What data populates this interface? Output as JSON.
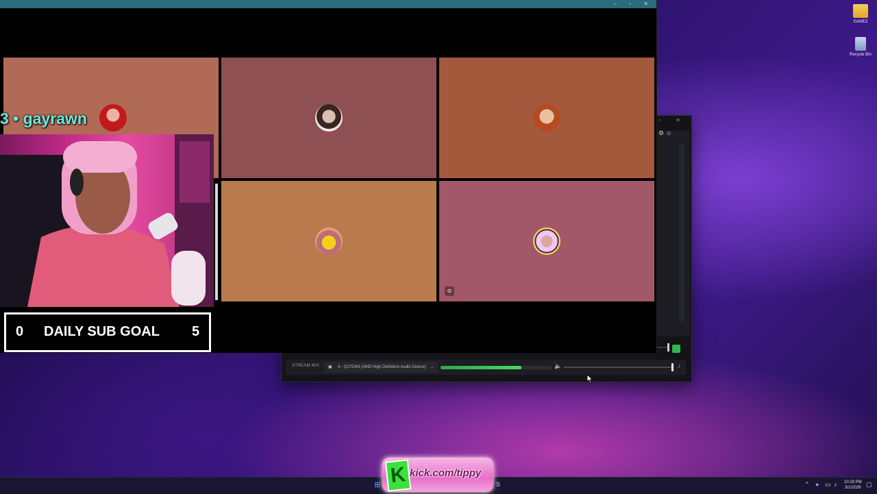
{
  "desktop": {
    "icons": [
      {
        "label": "GAMEZ",
        "icon": "folder-icon"
      },
      {
        "label": "Recycle Bin",
        "icon": "recycle-bin-icon"
      }
    ]
  },
  "call": {
    "participants": [
      {
        "name": "gayrawn",
        "tile_color": "#b06a56"
      },
      {
        "tile_color": "#8e5052"
      },
      {
        "tile_color": "#a5593c"
      },
      {
        "tile_color": "#b97a4d"
      },
      {
        "tile_color": "#a25868"
      }
    ]
  },
  "chat_overlay": {
    "prefix": "3 • ",
    "username": "gayrawn"
  },
  "sub_goal": {
    "current": "0",
    "label": "DAILY SUB GOAL",
    "target": "5"
  },
  "mixer": {
    "row_label": "STREAM MIX",
    "device": "4 - Q27G4N (AMD High Definition Audio Device)",
    "meter_level": 0.73,
    "volume_level": 1.0
  },
  "overlay_logo": {
    "letter": "K",
    "text": "kick.com/tippy"
  },
  "taskbar": {
    "time": "10:29 PM",
    "date": "3/1/2026"
  },
  "colors": {
    "desktop_bg": "#2a1166",
    "call_titlebar": "#2a6c7c",
    "chat_name": "#6ee6d8",
    "meter_green": "#45d865"
  }
}
